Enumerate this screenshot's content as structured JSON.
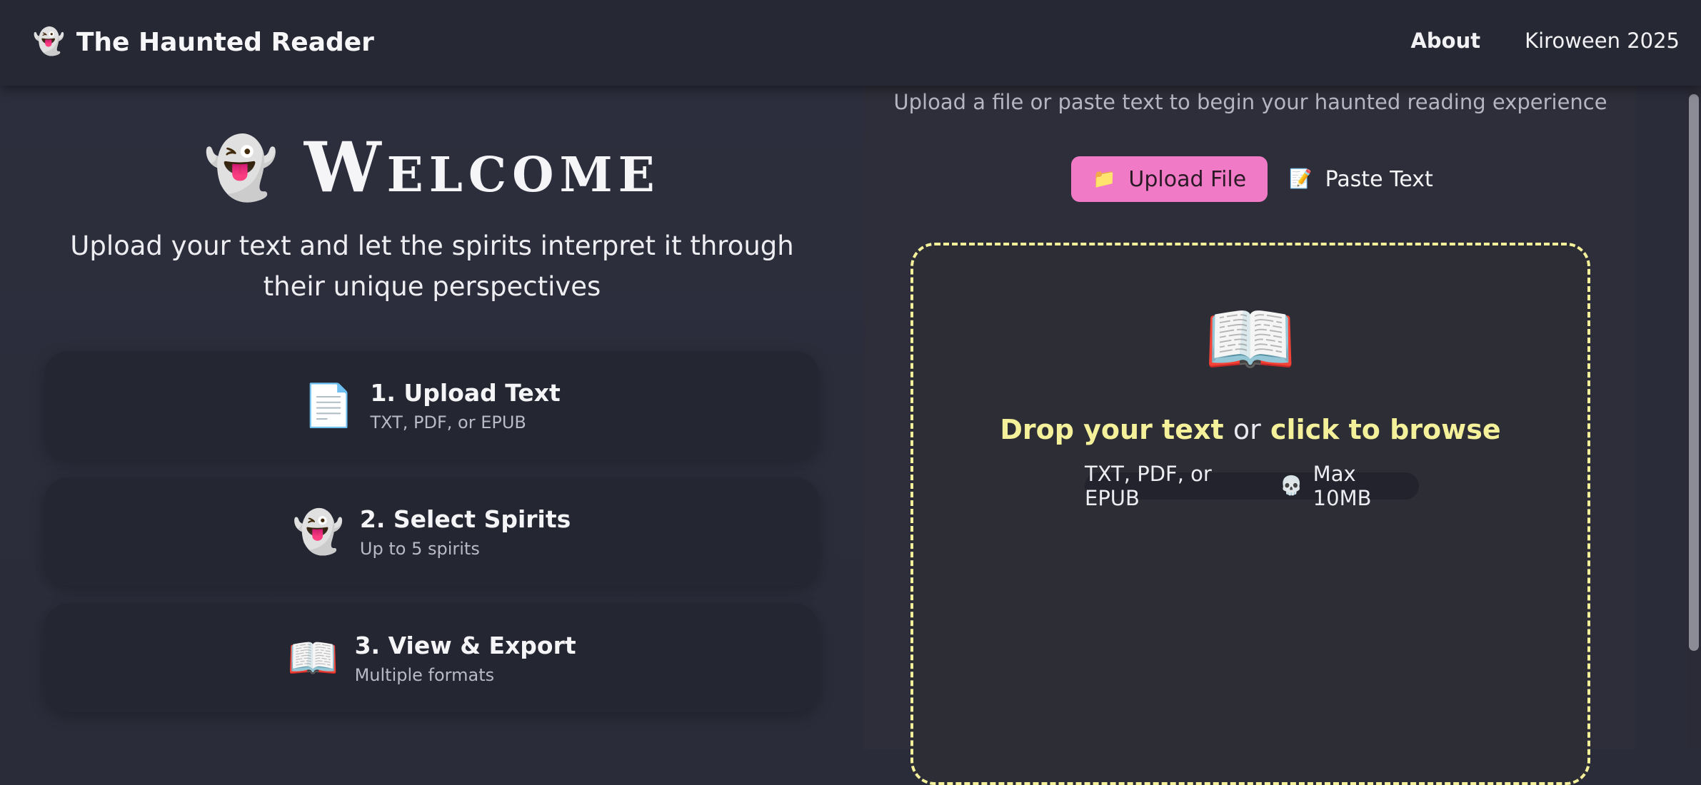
{
  "header": {
    "brand_icon": "ghost-icon",
    "brand_emoji": "👻",
    "brand_title": "The Haunted Reader",
    "nav": [
      "About",
      "Kiroween 2025"
    ]
  },
  "welcome": {
    "icon": "ghost-tongue-icon",
    "emoji": "👻",
    "title": "Welcome",
    "tagline": "Upload your text and let the spirits interpret it through their unique perspectives"
  },
  "steps": [
    {
      "icon": "document-icon",
      "emoji": "📄",
      "title": "1. Upload Text",
      "sub": "TXT, PDF, or EPUB"
    },
    {
      "icon": "ghost-icon",
      "emoji": "👻",
      "title": "2. Select Spirits",
      "sub": "Up to 5 spirits"
    },
    {
      "icon": "open-book-icon",
      "emoji": "📖",
      "title": "3. View & Export",
      "sub": "Multiple formats"
    }
  ],
  "upload": {
    "subtitle": "Upload a file or paste text to begin your haunted reading experience",
    "tabs": [
      {
        "icon": "folder-icon",
        "emoji": "📁",
        "label": "Upload File",
        "active": true
      },
      {
        "icon": "memo-icon",
        "emoji": "📝",
        "label": "Paste Text",
        "active": false
      }
    ],
    "dropzone": {
      "icon": "open-book-icon",
      "emoji": "📖",
      "drop": "Drop your text",
      "or": "or",
      "browse": "click to browse",
      "formats": "TXT, PDF, or EPUB",
      "separator_icon": "skull-icon",
      "separator_emoji": "💀",
      "max": "Max 10MB"
    }
  },
  "colors": {
    "accent_pink": "#f07ac6",
    "accent_yellow": "#f4f19a",
    "background": "#2a2c3a"
  }
}
